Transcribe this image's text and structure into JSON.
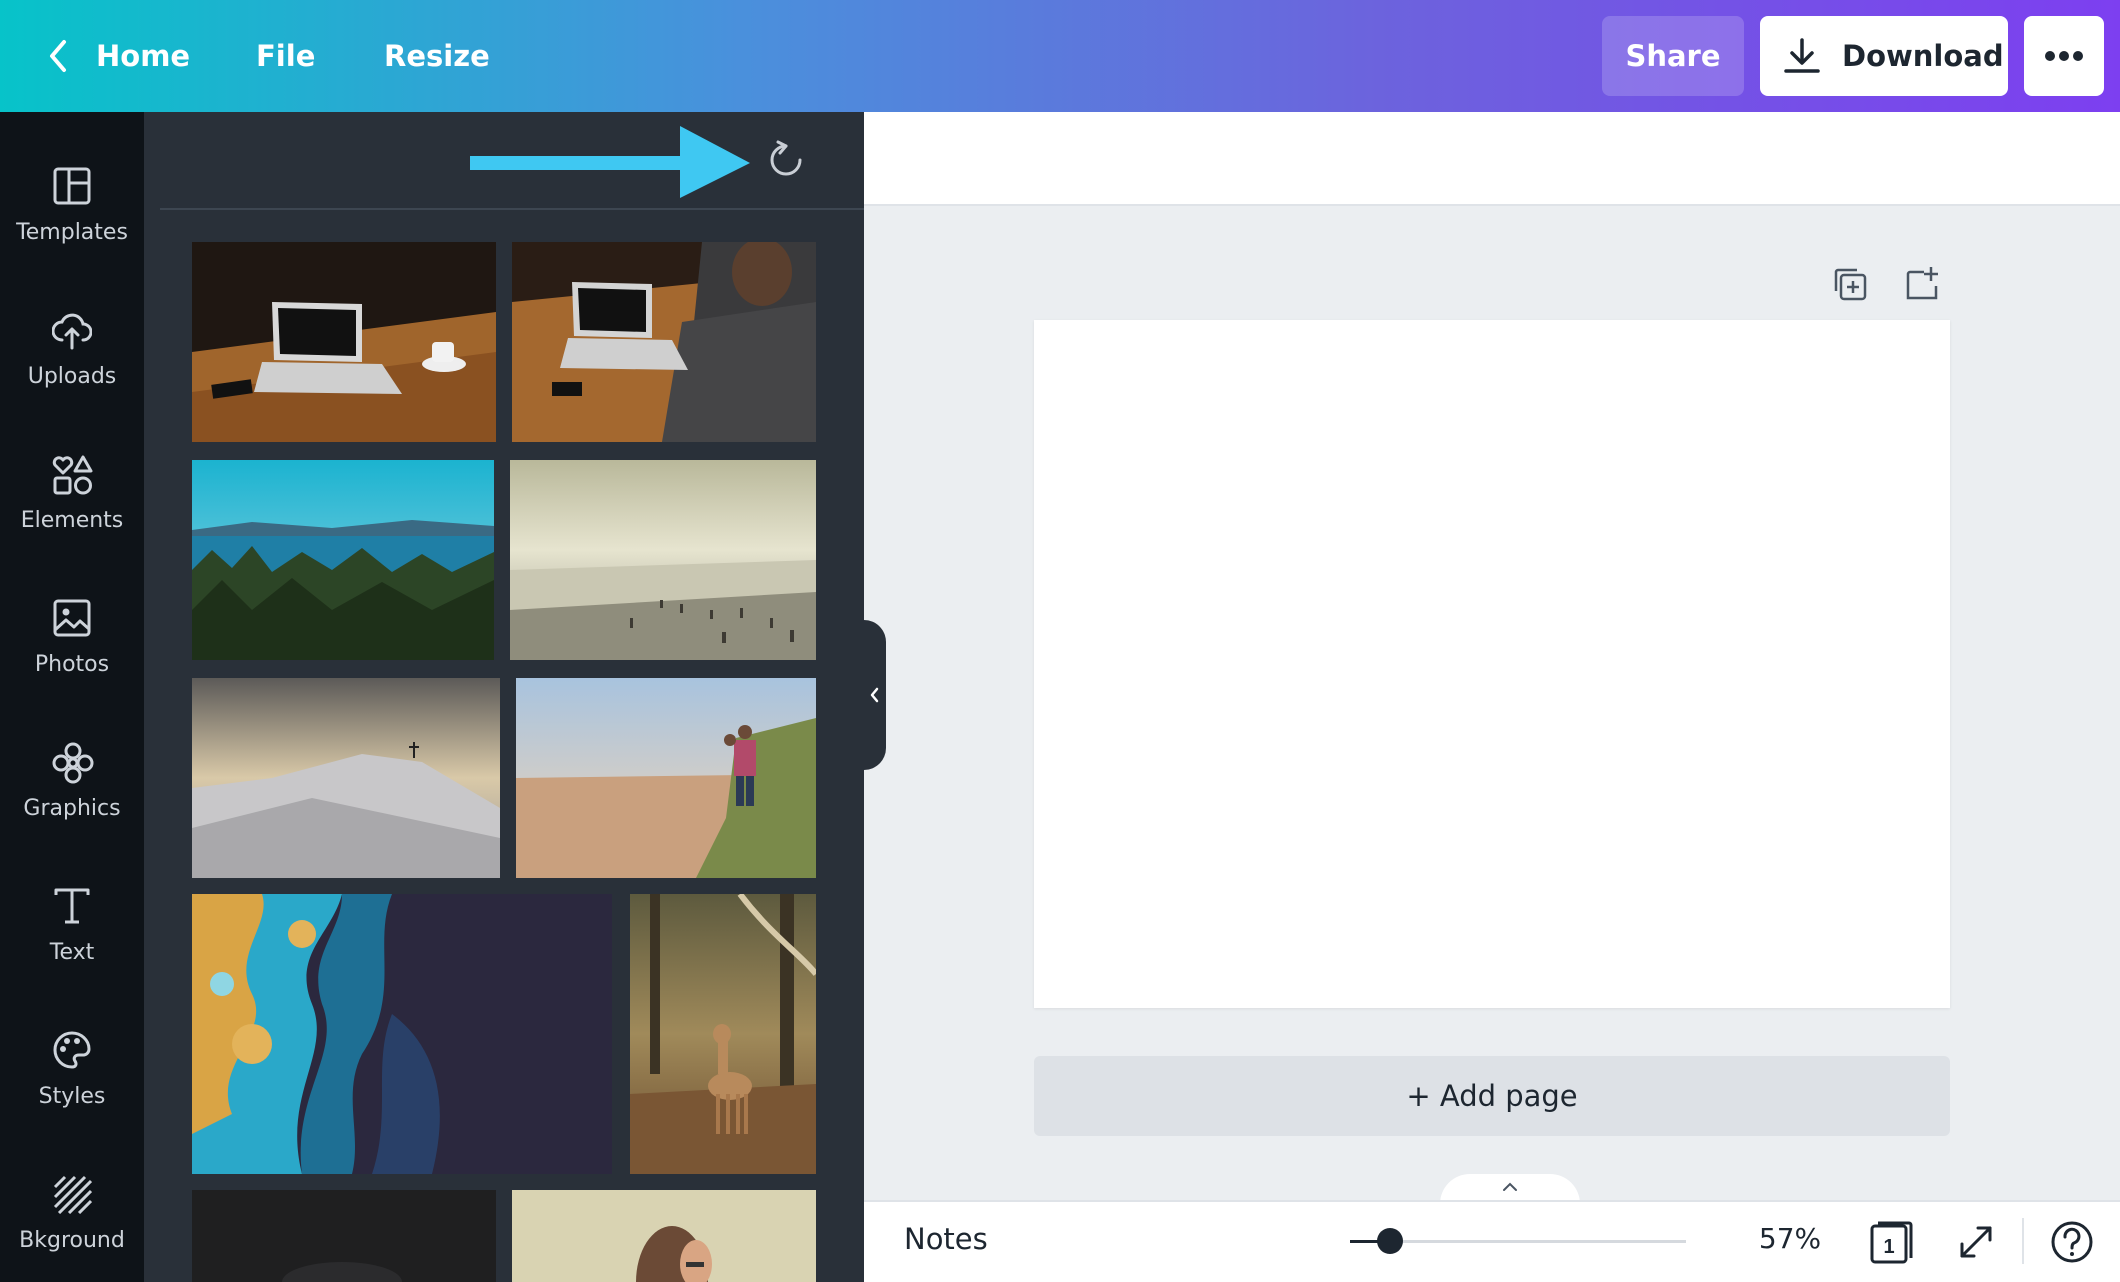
{
  "topbar": {
    "home": "Home",
    "file": "File",
    "resize": "Resize",
    "share": "Share",
    "download": "Download"
  },
  "rail": [
    {
      "icon": "templates-icon",
      "label": "Templates"
    },
    {
      "icon": "uploads-icon",
      "label": "Uploads"
    },
    {
      "icon": "elements-icon",
      "label": "Elements"
    },
    {
      "icon": "photos-icon",
      "label": "Photos"
    },
    {
      "icon": "graphics-icon",
      "label": "Graphics"
    },
    {
      "icon": "text-icon",
      "label": "Text"
    },
    {
      "icon": "styles-icon",
      "label": "Styles"
    },
    {
      "icon": "background-icon",
      "label": "Bkground"
    }
  ],
  "panel": {
    "photos": [
      "laptop-on-wooden-desk",
      "person-typing-on-laptop",
      "forest-and-sea-coast",
      "misty-beach-with-people",
      "snowy-hill-with-cross",
      "father-and-child-on-beach",
      "earth-from-space",
      "deer-in-forest",
      "dark-photo",
      "portrait-with-glasses"
    ]
  },
  "canvas": {
    "add_page": "+ Add page"
  },
  "bottombar": {
    "notes": "Notes",
    "zoom": "57%",
    "zoom_level": 0.12,
    "page_count": "1"
  },
  "colors": {
    "accent_arrow": "#3fc8f2",
    "rail_bg": "#0e1318",
    "panel_bg": "#293039"
  }
}
